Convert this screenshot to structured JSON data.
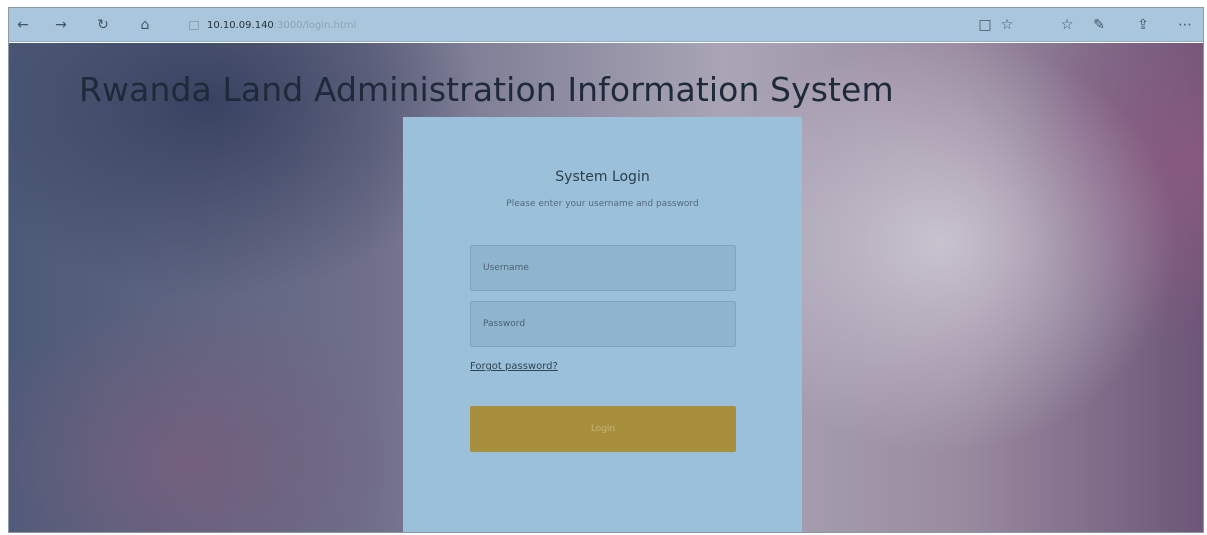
{
  "browser": {
    "back_icon": "←",
    "forward_icon": "→",
    "refresh_icon": "↻",
    "home_icon": "⌂",
    "url_host": "10.10.09.140",
    "url_path": ":3000/login.html",
    "reading_icon": "□",
    "favorite_icon": "☆",
    "favorites_hub_icon": "☆",
    "notes_icon": "✎",
    "share_icon": "⇪",
    "more_icon": "⋯"
  },
  "page": {
    "system_title": "Rwanda Land Administration Information System"
  },
  "login": {
    "title": "System Login",
    "subtitle": "Please enter your username and password",
    "username_placeholder": "Username",
    "password_placeholder": "Password",
    "forgot_label": "Forgot password?",
    "button_label": "Login"
  },
  "colors": {
    "panel": "#9ac0da",
    "button": "#a88f3d",
    "toolbar": "#a9c6dc"
  }
}
